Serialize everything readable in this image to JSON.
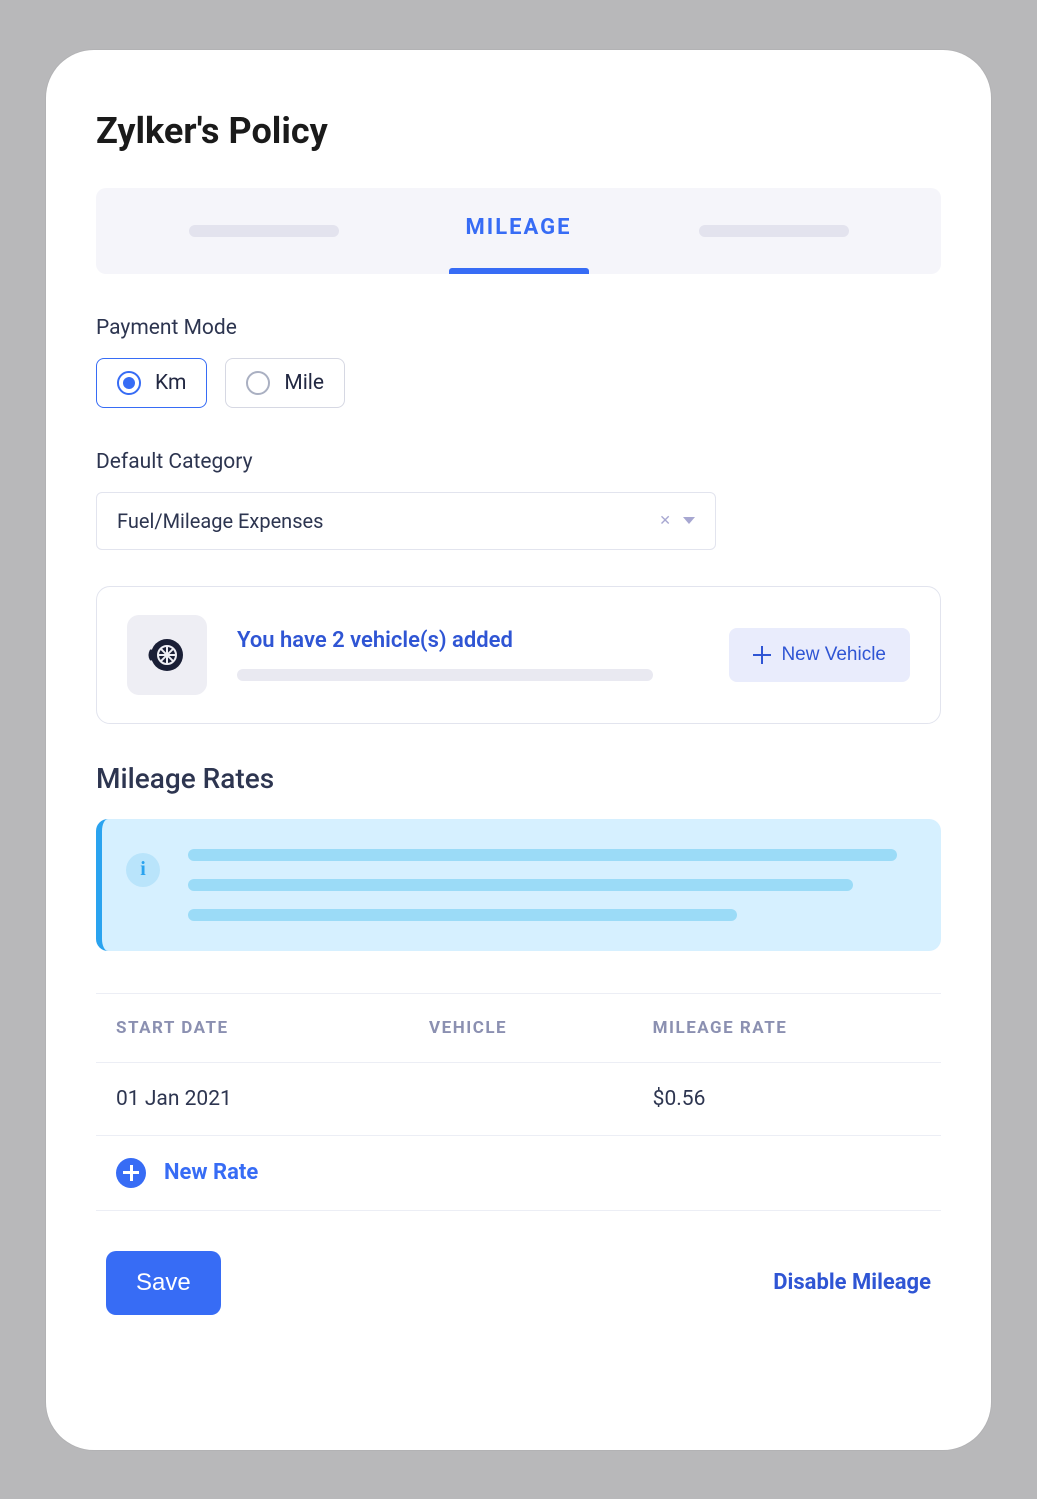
{
  "title": "Zylker's Policy",
  "tabs": {
    "active_label": "MILEAGE"
  },
  "payment_mode": {
    "label": "Payment Mode",
    "options": {
      "km": "Km",
      "mile": "Mile"
    },
    "selected": "km"
  },
  "default_category": {
    "label": "Default Category",
    "value": "Fuel/Mileage Expenses"
  },
  "vehicles_card": {
    "message": "You have 2 vehicle(s) added",
    "new_button": "New Vehicle"
  },
  "rates": {
    "heading": "Mileage Rates",
    "columns": {
      "start_date": "START DATE",
      "vehicle": "VEHICLE",
      "mileage_rate": "MILEAGE RATE"
    },
    "rows": [
      {
        "start_date": "01 Jan 2021",
        "vehicle": "",
        "mileage_rate": "$0.56"
      }
    ],
    "new_rate_label": "New Rate"
  },
  "footer": {
    "save": "Save",
    "disable": "Disable Mileage"
  },
  "colors": {
    "accent": "#376cf5",
    "info_bg": "#d6f0ff",
    "info_accent": "#2aa3ef"
  }
}
